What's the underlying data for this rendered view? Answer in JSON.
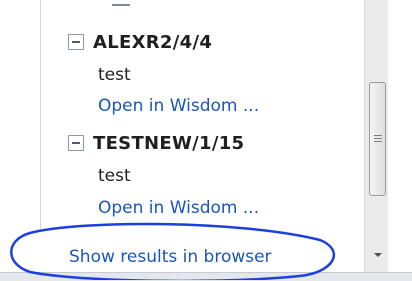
{
  "groups": [
    {
      "title": "ALEXR2/4/4",
      "description": "test",
      "link": "Open in Wisdom ..."
    },
    {
      "title": "TESTNEW/1/15",
      "description": "test",
      "link": "Open in Wisdom ..."
    }
  ],
  "footer": {
    "show_results_label": "Show results in browser"
  },
  "icons": {
    "collapse": "collapse-minus-icon",
    "scroll_down": "scroll-down-arrow-icon",
    "scroll_grip": "scrollbar-grip-icon"
  },
  "colors": {
    "link": "#1b57b8",
    "annotation": "#1d3fe0",
    "title_text": "#1f1f1f"
  }
}
